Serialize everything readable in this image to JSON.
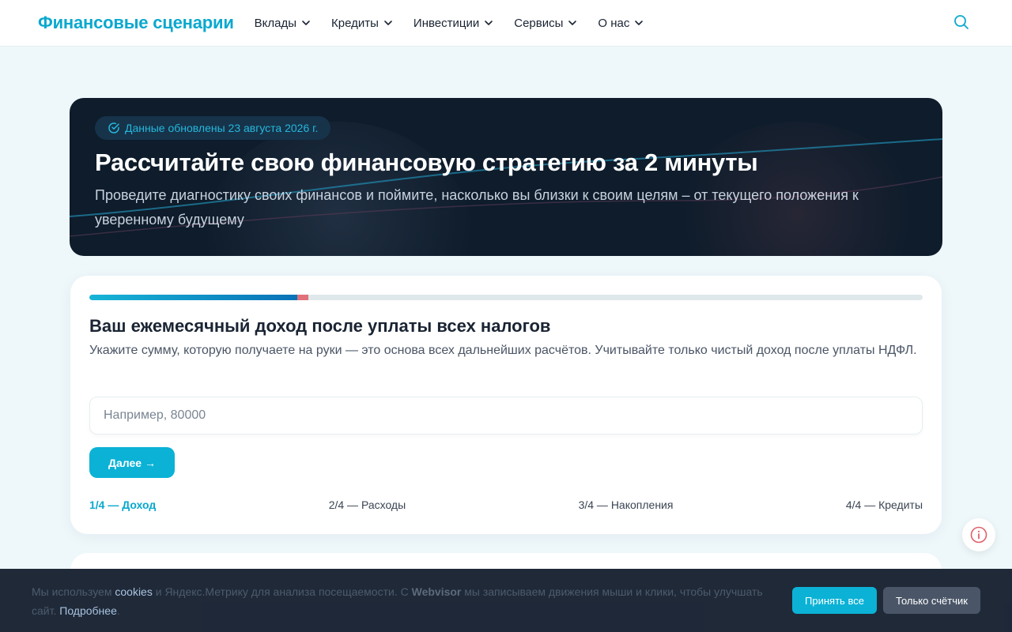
{
  "header": {
    "logo": "Финансовые сценарии",
    "nav": [
      {
        "label": "Вклады"
      },
      {
        "label": "Кредиты"
      },
      {
        "label": "Инвестиции"
      },
      {
        "label": "Сервисы"
      },
      {
        "label": "О нас"
      }
    ],
    "search_icon": "search-icon"
  },
  "hero": {
    "badge": "Данные обновлены 23 августа 2026 г.",
    "title": "Рассчитайте свою финансовую стратегию за 2 минуты",
    "subtitle": "Проведите диагностику своих финансов и поймите, насколько вы близки к своим целям – от текущего положения к уверенному будущему"
  },
  "quiz": {
    "progress_fraction": 0.25,
    "question": "Ваш ежемесячный доход после уплаты всех налогов",
    "hint": "Укажите сумму, которую получаете на руки — это основа всех дальнейших расчётов. Учитывайте только чистый доход после уплаты НДФЛ.",
    "input_value": "",
    "input_placeholder": "Например, 80000",
    "next_label": "Далее →",
    "steps": [
      {
        "label": "1/4 — Доход",
        "active": true
      },
      {
        "label": "2/4 — Расходы",
        "active": false
      },
      {
        "label": "3/4 — Накопления",
        "active": false
      },
      {
        "label": "4/4 — Кредиты",
        "active": false
      }
    ]
  },
  "cookie": {
    "t1": "Мы используем ",
    "link_cookies": "cookies",
    "t2": " и Яндекс.Метрику для анализа посещаемости. С ",
    "webvisor": "Webvisor",
    "t3": " мы записываем движения мыши и клики, чтобы улучшать сайт. ",
    "link_more": "Подробнее",
    "t4": ".",
    "accept_label": "Принять все",
    "counter_label": "Только счётчик"
  },
  "colors": {
    "accent": "#0bb2d6",
    "hero_bg": "#0e1c2b",
    "page_bg": "#eef7fa"
  }
}
